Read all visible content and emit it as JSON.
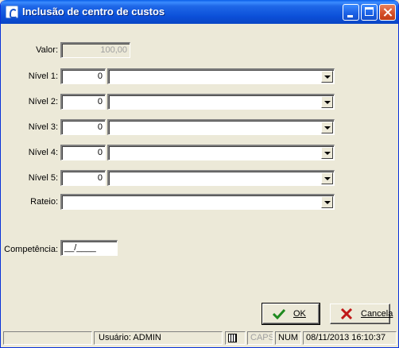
{
  "window": {
    "title": "Inclusão de centro de custos"
  },
  "form": {
    "valor": {
      "label": "Valor:",
      "value": "100,00"
    },
    "niveis": [
      {
        "label": "Nível 1:",
        "value": "0",
        "select": ""
      },
      {
        "label": "Nível 2:",
        "value": "0",
        "select": ""
      },
      {
        "label": "Nível 3:",
        "value": "0",
        "select": ""
      },
      {
        "label": "Nível 4:",
        "value": "0",
        "select": ""
      },
      {
        "label": "Nível 5:",
        "value": "0",
        "select": ""
      }
    ],
    "rateio": {
      "label": "Rateio:",
      "select": ""
    },
    "competencia": {
      "label": "Competência:",
      "value": "__/____"
    }
  },
  "buttons": {
    "ok": "OK",
    "cancel": "Cancela"
  },
  "statusbar": {
    "left": "",
    "user": "Usuário: ADMIN",
    "caps": "CAPS",
    "num": "NUM",
    "datetime": "08/11/2013 16:10:37"
  },
  "icons": {
    "app": "app-icon",
    "ok": "check-icon",
    "cancel": "x-icon",
    "calculator": "calculator-icon"
  }
}
